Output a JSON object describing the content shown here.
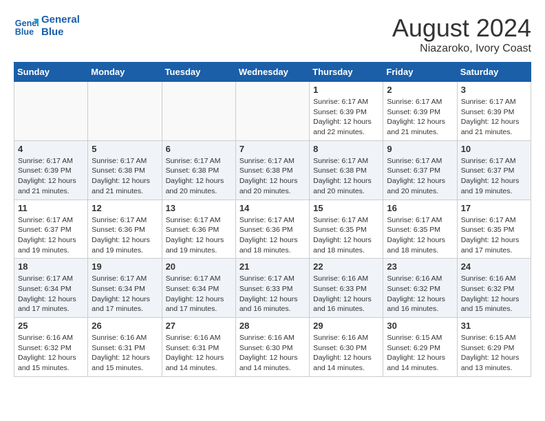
{
  "header": {
    "logo_line1": "General",
    "logo_line2": "Blue",
    "title": "August 2024",
    "subtitle": "Niazaroko, Ivory Coast"
  },
  "days_of_week": [
    "Sunday",
    "Monday",
    "Tuesday",
    "Wednesday",
    "Thursday",
    "Friday",
    "Saturday"
  ],
  "weeks": [
    [
      {
        "day": "",
        "info": ""
      },
      {
        "day": "",
        "info": ""
      },
      {
        "day": "",
        "info": ""
      },
      {
        "day": "",
        "info": ""
      },
      {
        "day": "1",
        "info": "Sunrise: 6:17 AM\nSunset: 6:39 PM\nDaylight: 12 hours\nand 22 minutes."
      },
      {
        "day": "2",
        "info": "Sunrise: 6:17 AM\nSunset: 6:39 PM\nDaylight: 12 hours\nand 21 minutes."
      },
      {
        "day": "3",
        "info": "Sunrise: 6:17 AM\nSunset: 6:39 PM\nDaylight: 12 hours\nand 21 minutes."
      }
    ],
    [
      {
        "day": "4",
        "info": "Sunrise: 6:17 AM\nSunset: 6:39 PM\nDaylight: 12 hours\nand 21 minutes."
      },
      {
        "day": "5",
        "info": "Sunrise: 6:17 AM\nSunset: 6:38 PM\nDaylight: 12 hours\nand 21 minutes."
      },
      {
        "day": "6",
        "info": "Sunrise: 6:17 AM\nSunset: 6:38 PM\nDaylight: 12 hours\nand 20 minutes."
      },
      {
        "day": "7",
        "info": "Sunrise: 6:17 AM\nSunset: 6:38 PM\nDaylight: 12 hours\nand 20 minutes."
      },
      {
        "day": "8",
        "info": "Sunrise: 6:17 AM\nSunset: 6:38 PM\nDaylight: 12 hours\nand 20 minutes."
      },
      {
        "day": "9",
        "info": "Sunrise: 6:17 AM\nSunset: 6:37 PM\nDaylight: 12 hours\nand 20 minutes."
      },
      {
        "day": "10",
        "info": "Sunrise: 6:17 AM\nSunset: 6:37 PM\nDaylight: 12 hours\nand 19 minutes."
      }
    ],
    [
      {
        "day": "11",
        "info": "Sunrise: 6:17 AM\nSunset: 6:37 PM\nDaylight: 12 hours\nand 19 minutes."
      },
      {
        "day": "12",
        "info": "Sunrise: 6:17 AM\nSunset: 6:36 PM\nDaylight: 12 hours\nand 19 minutes."
      },
      {
        "day": "13",
        "info": "Sunrise: 6:17 AM\nSunset: 6:36 PM\nDaylight: 12 hours\nand 19 minutes."
      },
      {
        "day": "14",
        "info": "Sunrise: 6:17 AM\nSunset: 6:36 PM\nDaylight: 12 hours\nand 18 minutes."
      },
      {
        "day": "15",
        "info": "Sunrise: 6:17 AM\nSunset: 6:35 PM\nDaylight: 12 hours\nand 18 minutes."
      },
      {
        "day": "16",
        "info": "Sunrise: 6:17 AM\nSunset: 6:35 PM\nDaylight: 12 hours\nand 18 minutes."
      },
      {
        "day": "17",
        "info": "Sunrise: 6:17 AM\nSunset: 6:35 PM\nDaylight: 12 hours\nand 17 minutes."
      }
    ],
    [
      {
        "day": "18",
        "info": "Sunrise: 6:17 AM\nSunset: 6:34 PM\nDaylight: 12 hours\nand 17 minutes."
      },
      {
        "day": "19",
        "info": "Sunrise: 6:17 AM\nSunset: 6:34 PM\nDaylight: 12 hours\nand 17 minutes."
      },
      {
        "day": "20",
        "info": "Sunrise: 6:17 AM\nSunset: 6:34 PM\nDaylight: 12 hours\nand 17 minutes."
      },
      {
        "day": "21",
        "info": "Sunrise: 6:17 AM\nSunset: 6:33 PM\nDaylight: 12 hours\nand 16 minutes."
      },
      {
        "day": "22",
        "info": "Sunrise: 6:16 AM\nSunset: 6:33 PM\nDaylight: 12 hours\nand 16 minutes."
      },
      {
        "day": "23",
        "info": "Sunrise: 6:16 AM\nSunset: 6:32 PM\nDaylight: 12 hours\nand 16 minutes."
      },
      {
        "day": "24",
        "info": "Sunrise: 6:16 AM\nSunset: 6:32 PM\nDaylight: 12 hours\nand 15 minutes."
      }
    ],
    [
      {
        "day": "25",
        "info": "Sunrise: 6:16 AM\nSunset: 6:32 PM\nDaylight: 12 hours\nand 15 minutes."
      },
      {
        "day": "26",
        "info": "Sunrise: 6:16 AM\nSunset: 6:31 PM\nDaylight: 12 hours\nand 15 minutes."
      },
      {
        "day": "27",
        "info": "Sunrise: 6:16 AM\nSunset: 6:31 PM\nDaylight: 12 hours\nand 14 minutes."
      },
      {
        "day": "28",
        "info": "Sunrise: 6:16 AM\nSunset: 6:30 PM\nDaylight: 12 hours\nand 14 minutes."
      },
      {
        "day": "29",
        "info": "Sunrise: 6:16 AM\nSunset: 6:30 PM\nDaylight: 12 hours\nand 14 minutes."
      },
      {
        "day": "30",
        "info": "Sunrise: 6:15 AM\nSunset: 6:29 PM\nDaylight: 12 hours\nand 14 minutes."
      },
      {
        "day": "31",
        "info": "Sunrise: 6:15 AM\nSunset: 6:29 PM\nDaylight: 12 hours\nand 13 minutes."
      }
    ]
  ]
}
